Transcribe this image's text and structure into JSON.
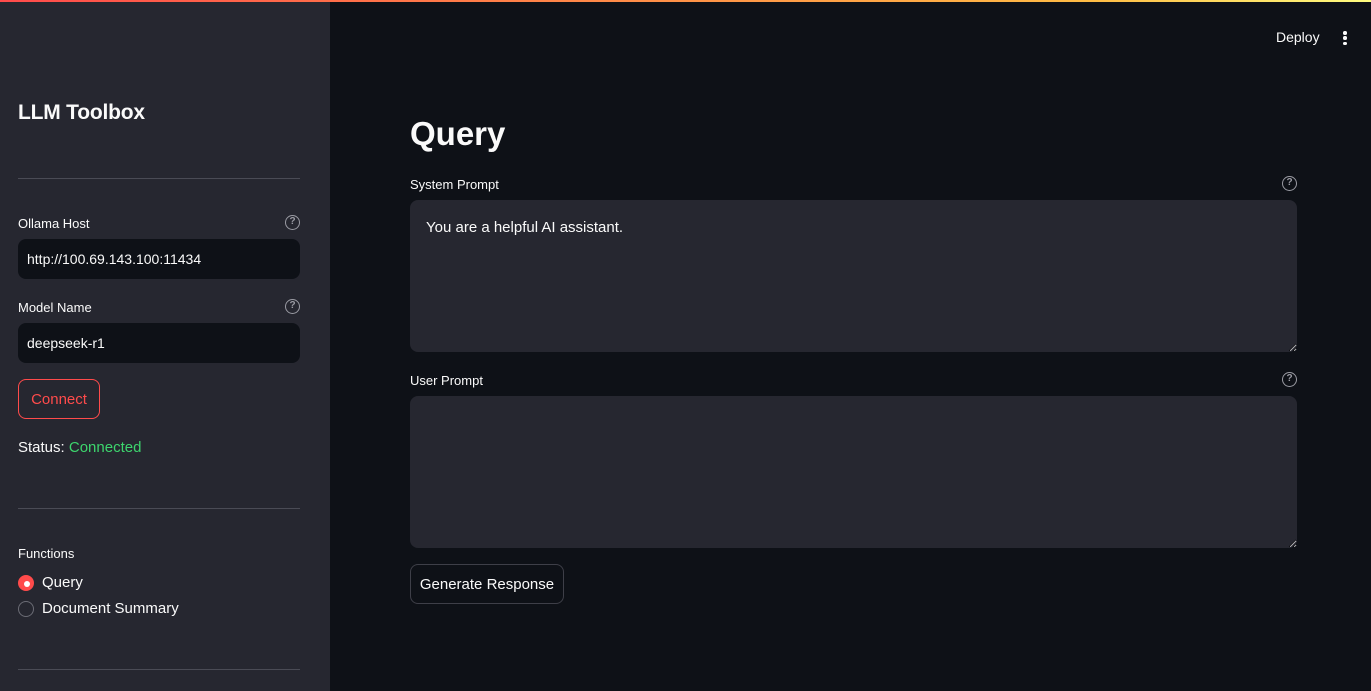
{
  "sidebar": {
    "title": "LLM Toolbox",
    "ollama_host": {
      "label": "Ollama Host",
      "value": "http://100.69.143.100:11434",
      "help": "?"
    },
    "model_name": {
      "label": "Model Name",
      "value": "deepseek-r1",
      "help": "?"
    },
    "connect_label": "Connect",
    "status": {
      "label": "Status:",
      "value": "Connected"
    },
    "functions": {
      "label": "Functions",
      "options": [
        {
          "label": "Query",
          "selected": true
        },
        {
          "label": "Document Summary",
          "selected": false
        }
      ]
    }
  },
  "header": {
    "deploy_label": "Deploy"
  },
  "main": {
    "title": "Query",
    "system_prompt": {
      "label": "System Prompt",
      "value": "You are a helpful AI assistant.",
      "help": "?"
    },
    "user_prompt": {
      "label": "User Prompt",
      "value": "",
      "help": "?"
    },
    "generate_label": "Generate Response"
  },
  "colors": {
    "accent": "#ff4b4b",
    "success": "#3dd56d",
    "background": "#0e1117",
    "sidebar_bg": "#262730"
  }
}
